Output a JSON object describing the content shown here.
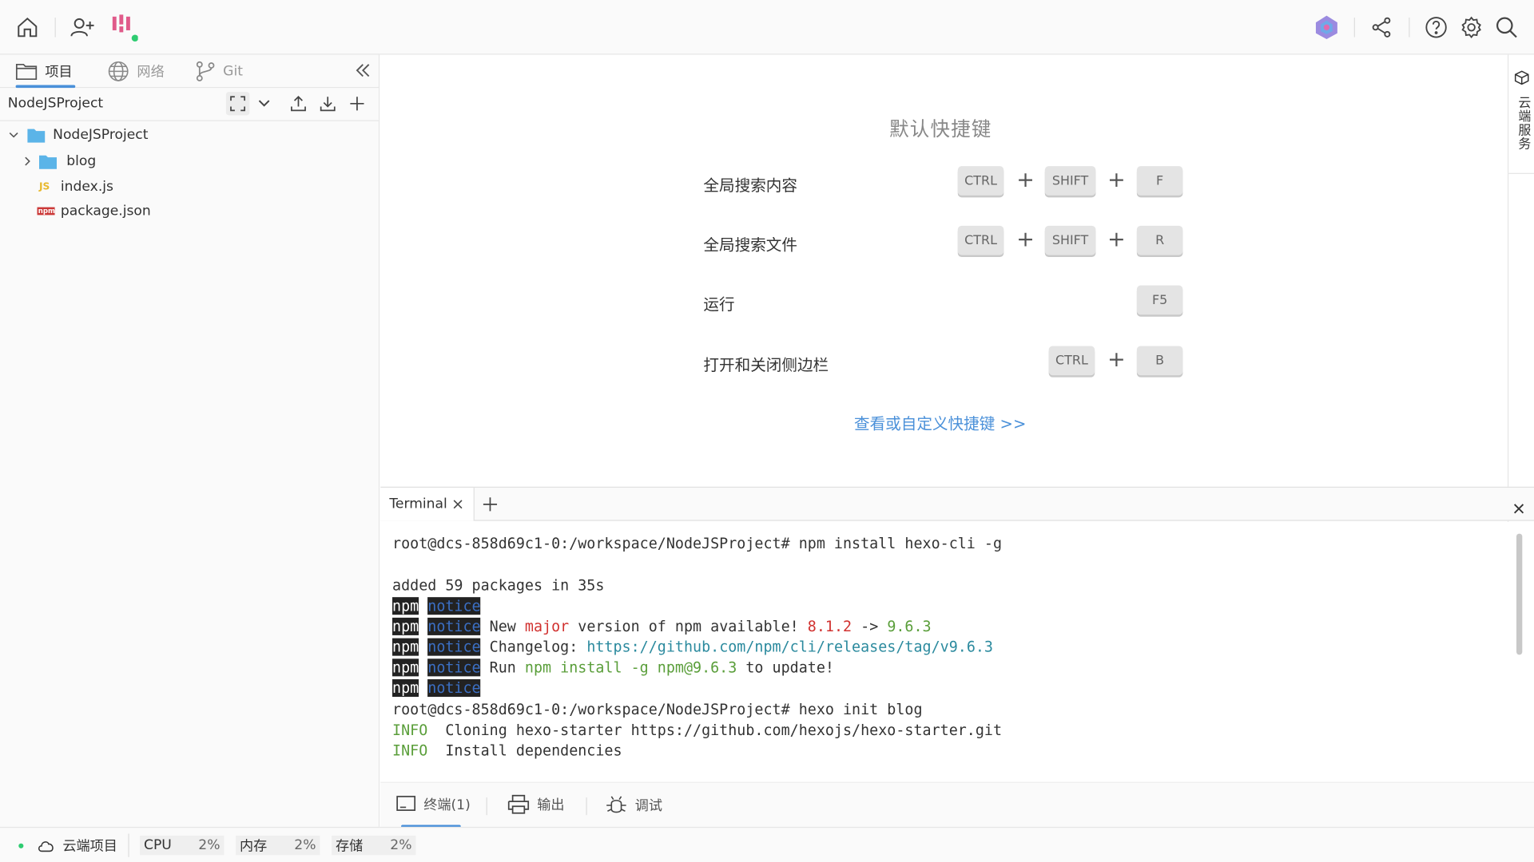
{
  "topbar": {
    "icons": [
      "home-icon",
      "add-user-icon",
      "app-logo-icon",
      "ai-assistant-icon",
      "share-icon",
      "help-icon",
      "settings-icon",
      "search-icon"
    ]
  },
  "sidebar": {
    "tabs": [
      {
        "label": "项目",
        "icon": "folder-icon",
        "active": true
      },
      {
        "label": "网络",
        "icon": "globe-icon",
        "active": false
      },
      {
        "label": "Git",
        "icon": "git-branch-icon",
        "active": false
      }
    ],
    "project_name": "NodeJSProject",
    "tree": [
      {
        "label": "NodeJSProject",
        "type": "folder",
        "expanded": true
      },
      {
        "label": "blog",
        "type": "folder",
        "expanded": false
      },
      {
        "label": "index.js",
        "type": "js",
        "badge": "JS"
      },
      {
        "label": "package.json",
        "type": "json",
        "badge": "npm"
      }
    ]
  },
  "shortcuts": {
    "title": "默认快捷键",
    "rows": [
      {
        "label": "全局搜索内容",
        "keys": [
          "CTRL",
          "SHIFT",
          "F"
        ]
      },
      {
        "label": "全局搜索文件",
        "keys": [
          "CTRL",
          "SHIFT",
          "R"
        ]
      },
      {
        "label": "运行",
        "keys": [
          "F5"
        ]
      },
      {
        "label": "打开和关闭侧边栏",
        "keys": [
          "CTRL",
          "B"
        ]
      }
    ],
    "plus": "+",
    "link": "查看或自定义快捷键 >>"
  },
  "right_panel": {
    "label": "云端服务"
  },
  "terminal": {
    "tab_label": "Terminal",
    "lines": {
      "l1": "root@dcs-858d69c1-0:/workspace/NodeJSProject# npm install hexo-cli -g",
      "l2": "added 59 packages in 35s",
      "npm": "npm",
      "notice": "notice",
      "n2a": "New ",
      "n2b": "major",
      "n2c": " version of npm available! ",
      "n2d": "8.1.2",
      "n2e": " -> ",
      "n2f": "9.6.3",
      "n3a": "Changelog: ",
      "n3b": "https://github.com/npm/cli/releases/tag/v9.6.3",
      "n4a": "Run ",
      "n4b": "npm install -g npm@9.6.3",
      "n4c": " to update!",
      "l3": "root@dcs-858d69c1-0:/workspace/NodeJSProject# hexo init blog",
      "info": "INFO",
      "i1": "  Cloning hexo-starter https://github.com/hexojs/hexo-starter.git",
      "i2": "  Install dependencies"
    }
  },
  "bottom_tabs": [
    {
      "label": "终端(1)",
      "icon": "terminal-icon",
      "active": true
    },
    {
      "label": "输出",
      "icon": "printer-icon",
      "active": false
    },
    {
      "label": "调试",
      "icon": "bug-icon",
      "active": false
    }
  ],
  "statusbar": {
    "project": "云端项目",
    "cpu_label": "CPU",
    "cpu_value": "2%",
    "mem_label": "内存",
    "mem_value": "2%",
    "storage_label": "存储",
    "storage_value": "2%"
  },
  "colors": {
    "accent": "#4a90d9",
    "status_dot": "#2ecc71"
  }
}
